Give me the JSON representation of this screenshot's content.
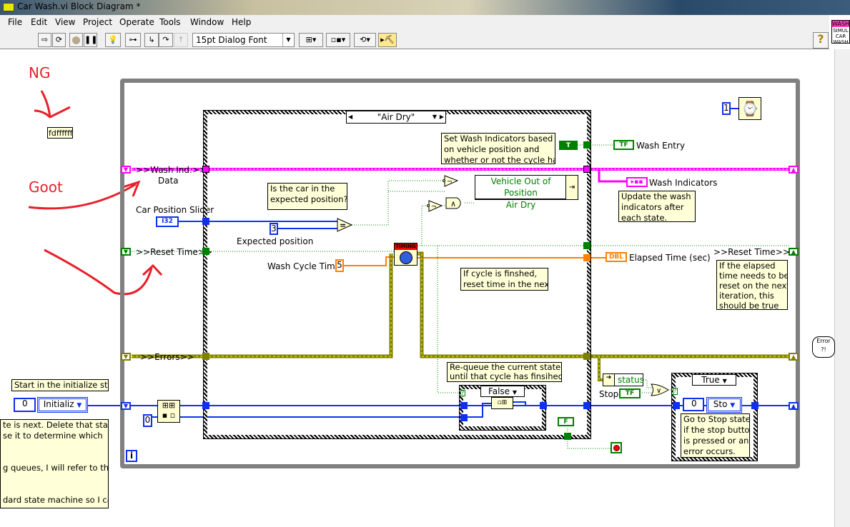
{
  "window": {
    "title": "Car Wash.vi Block Diagram *"
  },
  "menu": [
    "File",
    "Edit",
    "View",
    "Project",
    "Operate",
    "Tools",
    "Window",
    "Help"
  ],
  "toolbar": {
    "font": "15pt Dialog Font",
    "buttons": [
      "run-arrow",
      "run-continuously",
      "abort",
      "pause",
      "highlight-execution",
      "retain-wire-values",
      "step-into",
      "step-over",
      "step-out",
      "align-objects",
      "distribute-objects",
      "reorder",
      "clean-up-diagram"
    ],
    "help": "?"
  },
  "vi_icon": {
    "top": "WASH",
    "lines": "SIMUL CAR WASH"
  },
  "annotations": {
    "ng": "NG",
    "ng_label": "fdffffff",
    "goot": "Goot"
  },
  "loop": {
    "wash_ind": ">>Wash Ind.>>",
    "data": "Data",
    "car_position": "Car Position Slider",
    "i32": "I32",
    "reset_time": ">>Reset Time>>",
    "errors": ">>Errors>>",
    "iteration": "i",
    "start_comment": "Start in the initialize state",
    "init_num": "0",
    "init_enum": "Initializ",
    "left_comment": [
      "te is next. Delete that state",
      "se it to determine which",
      "",
      "g queues, I will refer to this",
      "",
      "dard state machine so I can"
    ],
    "queue_index": "0",
    "wait_const": "1",
    "reset_time_out": ">>Reset Time>>",
    "reset_comment": [
      "If the elapsed",
      "time needs to be",
      "reset on the next",
      "iteration, this",
      "should be true"
    ],
    "wash_entry": "Wash Entry",
    "wash_indicators": "Wash Indicators",
    "elapsed": "Elapsed Time (sec)",
    "update_comment": [
      "Update the wash",
      "indicators after",
      "each state."
    ],
    "status": "status",
    "stop": "Stop",
    "tf": "TF",
    "dbl": "DBL"
  },
  "case": {
    "selector": "\"Air Dry\"",
    "position_comment": [
      "Is the car in the",
      "expected position?"
    ],
    "expected_const": "3",
    "expected_label": "Expected position",
    "cycle_label": "Wash Cycle Time",
    "cycle_const": "5",
    "timing": "TIMING",
    "set_comment": [
      "Set Wash Indicators based",
      "on vehicle position and",
      "whether or not the cycle has"
    ],
    "bundle": [
      "Vehicle Out of Position",
      "Air Dry"
    ],
    "cycle_comment": [
      "If cycle is finshed,",
      "reset time in the next"
    ],
    "requeue_comment": [
      "Re-queue the current state",
      "until that cycle has finsihed"
    ],
    "inner_selector": "False",
    "false_const": "F",
    "true_const": "T"
  },
  "stop_case": {
    "selector": "True",
    "num": "0",
    "enum": "Sto",
    "comment": [
      "Go to Stop state",
      "if the stop button",
      "is pressed or an",
      "error occurs."
    ]
  },
  "colors": {
    "boolean": "#008000",
    "integer": "#1030f0",
    "cluster": "#ff00ff",
    "double": "#ff8000",
    "error": "#808000",
    "annotation": "#e8202a"
  }
}
